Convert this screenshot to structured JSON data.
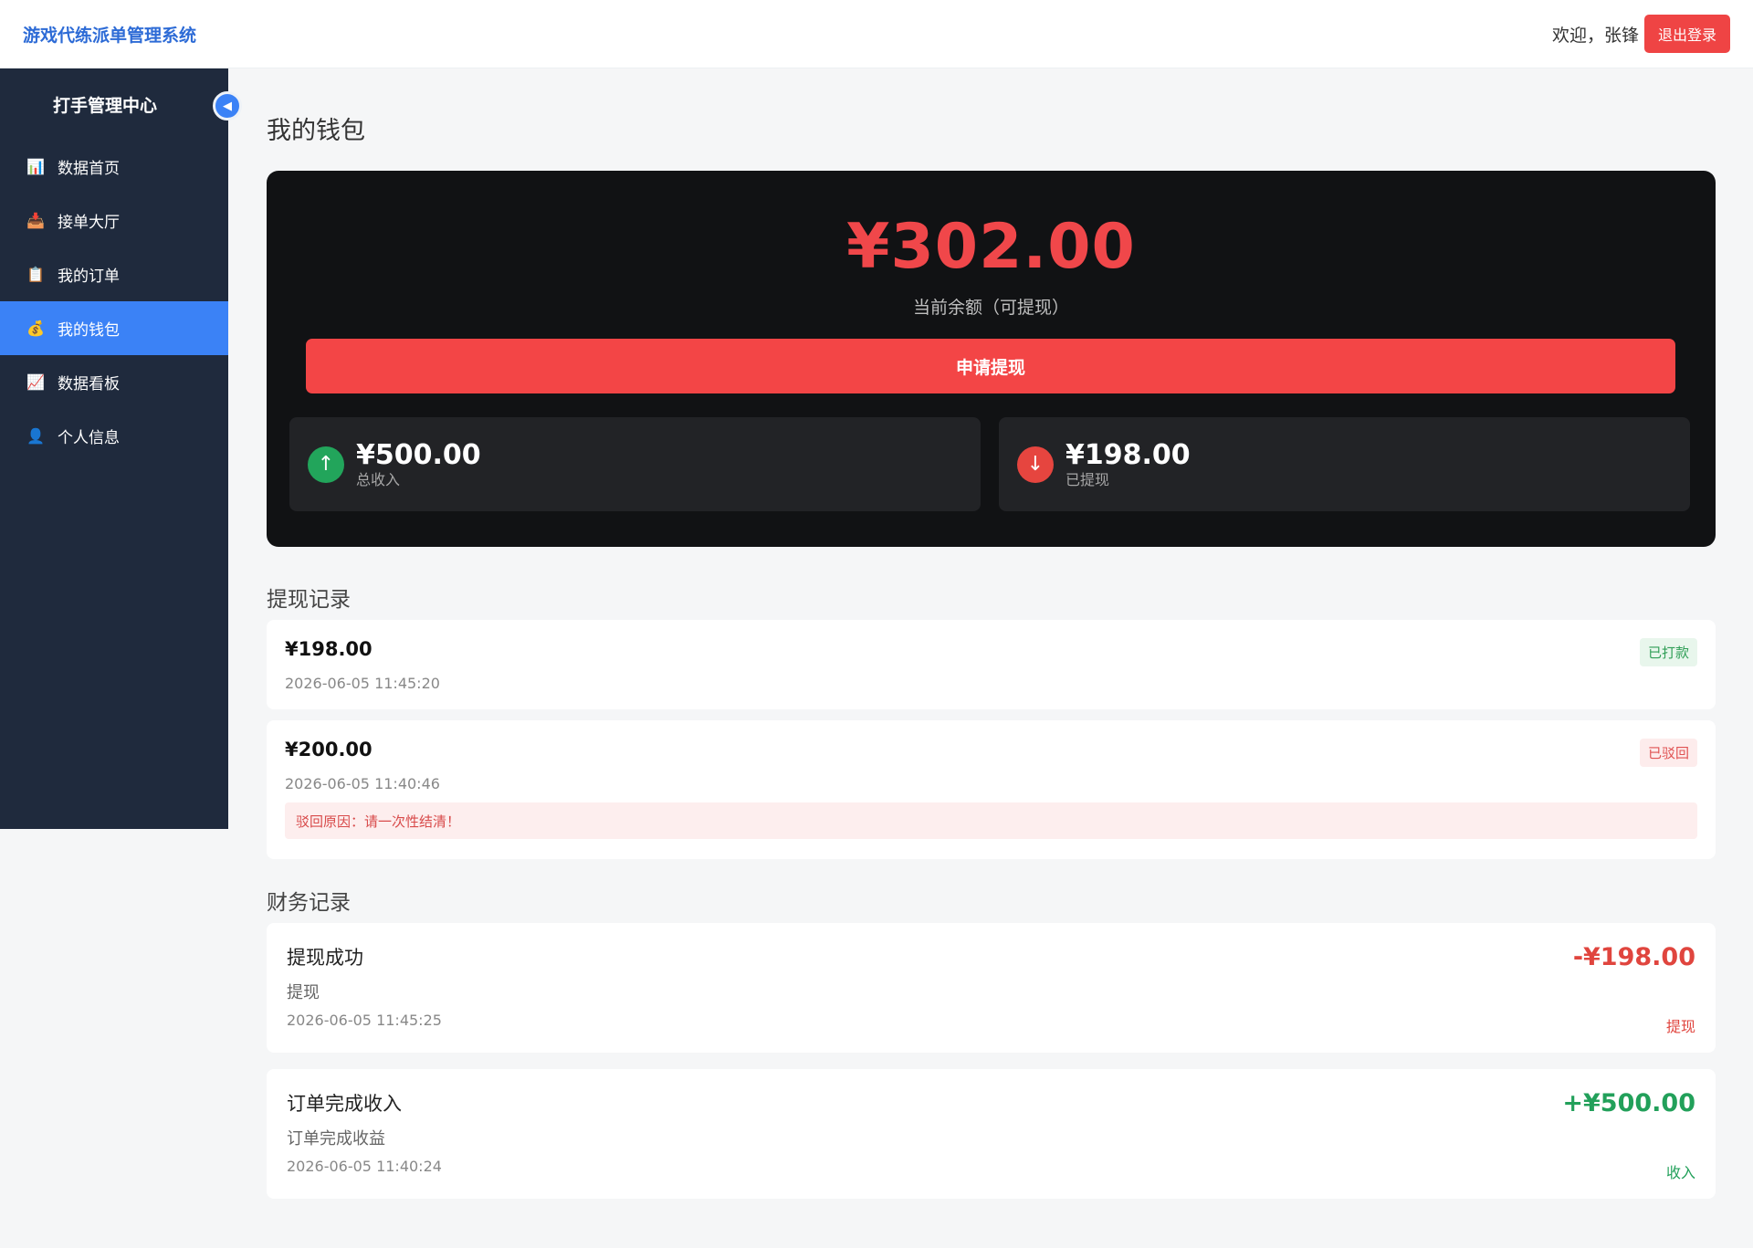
{
  "header": {
    "app_title": "游戏代练派单管理系统",
    "welcome": "欢迎，张锋",
    "logout_label": "退出登录"
  },
  "sidebar": {
    "title": "打手管理中心",
    "collapse_icon": "◀",
    "items": [
      {
        "icon": "📊",
        "label": "数据首页",
        "active": false
      },
      {
        "icon": "📥",
        "label": "接单大厅",
        "active": false
      },
      {
        "icon": "📋",
        "label": "我的订单",
        "active": false
      },
      {
        "icon": "💰",
        "label": "我的钱包",
        "active": true
      },
      {
        "icon": "📈",
        "label": "数据看板",
        "active": false
      },
      {
        "icon": "👤",
        "label": "个人信息",
        "active": false
      }
    ]
  },
  "main": {
    "page_title": "我的钱包",
    "wallet": {
      "balance": "¥302.00",
      "balance_label": "当前余额（可提现）",
      "withdraw_button": "申请提现",
      "income": {
        "icon": "↑",
        "amount": "¥500.00",
        "label": "总收入"
      },
      "withdrawn": {
        "icon": "↓",
        "amount": "¥198.00",
        "label": "已提现"
      }
    },
    "withdraw_records_title": "提现记录",
    "withdraw_records": [
      {
        "amount": "¥198.00",
        "time": "2026-06-05 11:45:20",
        "status": "已打款"
      },
      {
        "amount": "¥200.00",
        "time": "2026-06-05 11:40:46",
        "status": "已驳回",
        "reason": "驳回原因：请一次性结清！"
      }
    ],
    "finance_records_title": "财务记录",
    "finance_records": [
      {
        "title": "提现成功",
        "desc": "提现",
        "time": "2026-06-05 11:45:25",
        "amount": "-¥198.00",
        "type": "提现"
      },
      {
        "title": "订单完成收入",
        "desc": "订单完成收益",
        "time": "2026-06-05 11:40:24",
        "amount": "+¥500.00",
        "type": "收入"
      }
    ]
  },
  "colors": {
    "accent": "#3b82f6",
    "danger": "#f34546",
    "success": "#22a55b",
    "sidebar_bg": "#1f2a3d"
  }
}
